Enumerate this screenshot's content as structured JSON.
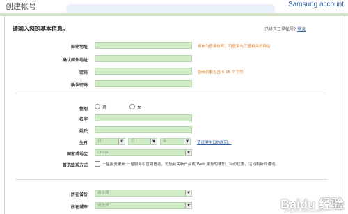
{
  "header": {
    "title": "创建帐号",
    "brand": "Samsung account"
  },
  "section": {
    "title": "请输入您的基本信息。",
    "login_prompt": "已经有三星帐号?",
    "login_link": "登录"
  },
  "account": {
    "email_label": "邮件地址",
    "email_hint": "将作为登录帐号，可登录与三星相关的网站",
    "confirm_email_label": "确认邮件地址",
    "password_label": "密码",
    "password_hint": "密码只能包含 6-15 个字符",
    "confirm_password_label": "确认密码"
  },
  "profile": {
    "gender_label": "性别",
    "gender_options": [
      "男",
      "女"
    ],
    "first_name_label": "名字",
    "last_name_label": "姓氏",
    "birthday_label": "生日",
    "birthday_selects": [
      "日",
      "月",
      "年"
    ],
    "birthday_link": "请说明生日的原因。",
    "country_label": "国家或地区",
    "country_value": "China",
    "contact_label": "首选联系方式",
    "contact_text": "三星服务更新:三星服务和营销信息，包括有关新产品或 Web 服务的通知、特价优惠、活动和新闻通讯。"
  },
  "address": {
    "province_label": "所在省份",
    "province_placeholder": "请选择",
    "city_label": "所在城市",
    "city_placeholder": "请选择"
  },
  "watermark": {
    "text": "Baidu 经验",
    "sub": "jingyan.baidu.com"
  }
}
